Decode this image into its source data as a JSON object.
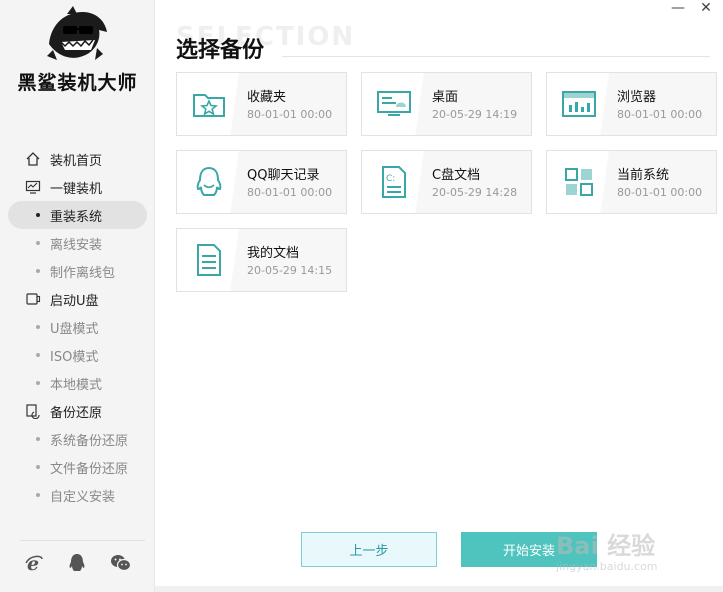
{
  "app": {
    "brand": "黑鲨装机大师",
    "window_controls": {
      "minimize": "—",
      "close": "✕"
    }
  },
  "sidebar": {
    "groups": [
      {
        "label": "装机首页",
        "icon": "home-icon",
        "items": []
      },
      {
        "label": "一键装机",
        "icon": "monitor-icon",
        "items": [
          {
            "label": "重装系统",
            "active": true
          },
          {
            "label": "离线安装",
            "active": false
          },
          {
            "label": "制作离线包",
            "active": false
          }
        ]
      },
      {
        "label": "启动U盘",
        "icon": "usb-icon",
        "items": [
          {
            "label": "U盘模式",
            "active": false
          },
          {
            "label": "ISO模式",
            "active": false
          },
          {
            "label": "本地模式",
            "active": false
          }
        ]
      },
      {
        "label": "备份还原",
        "icon": "backup-icon",
        "items": [
          {
            "label": "系统备份还原",
            "active": false
          },
          {
            "label": "文件备份还原",
            "active": false
          },
          {
            "label": "自定义安装",
            "active": false
          }
        ]
      }
    ],
    "social_icons": [
      "ie-browser-icon",
      "qq-icon",
      "wechat-icon"
    ]
  },
  "main": {
    "watermark": "SELECTION",
    "title": "选择备份",
    "cards": [
      {
        "title": "收藏夹",
        "date": "80-01-01 00:00",
        "icon": "favorites-folder-icon"
      },
      {
        "title": "桌面",
        "date": "20-05-29 14:19",
        "icon": "desktop-icon"
      },
      {
        "title": "浏览器",
        "date": "80-01-01 00:00",
        "icon": "browser-icon"
      },
      {
        "title": "QQ聊天记录",
        "date": "80-01-01 00:00",
        "icon": "qq-chat-icon"
      },
      {
        "title": "C盘文档",
        "date": "20-05-29 14:28",
        "icon": "c-drive-document-icon"
      },
      {
        "title": "当前系统",
        "date": "80-01-01 00:00",
        "icon": "system-grid-icon"
      },
      {
        "title": "我的文档",
        "date": "20-05-29 14:15",
        "icon": "my-documents-icon"
      }
    ]
  },
  "buttons": {
    "prev": "上一步",
    "start": "开始安装"
  },
  "watermark_overlay": {
    "text": "Bai 经验",
    "sub": "jingyan.baidu.com"
  },
  "colors": {
    "accent": "#4fc3bd",
    "icon_teal": "#3aa7a7",
    "active_bg": "#e2e2e2"
  }
}
